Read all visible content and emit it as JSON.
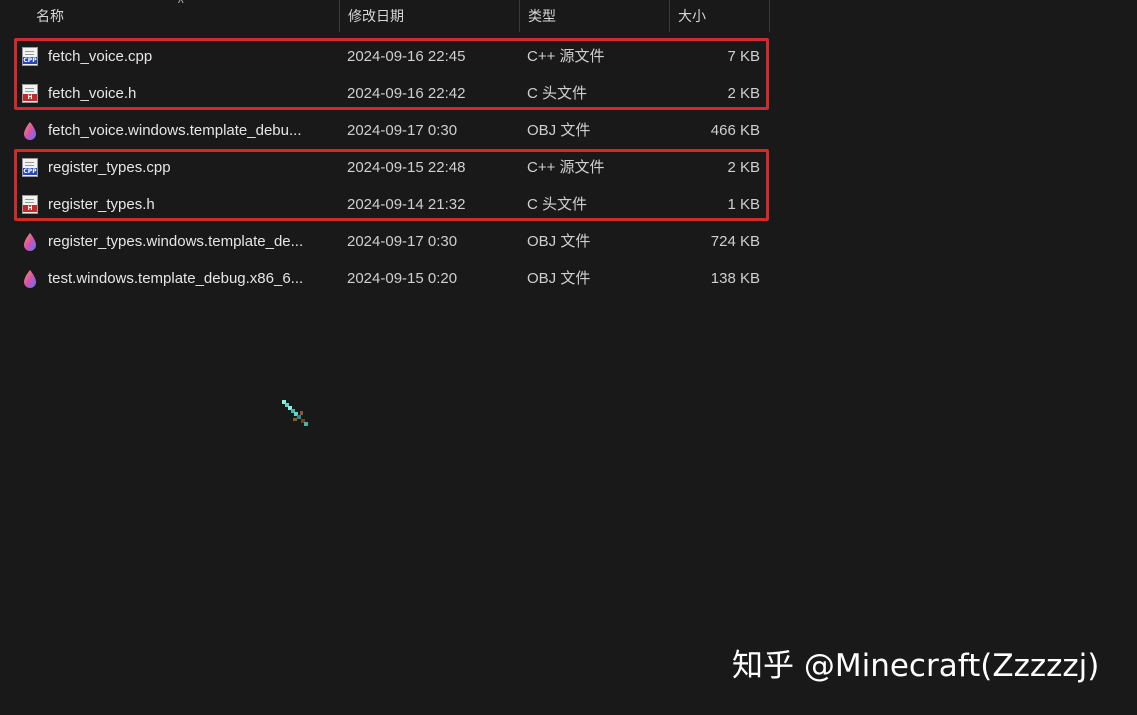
{
  "columns": {
    "name": "名称",
    "date": "修改日期",
    "type": "类型",
    "size": "大小"
  },
  "sort_indicator": "^",
  "files": [
    {
      "name": "fetch_voice.cpp",
      "date": "2024-09-16 22:45",
      "type": "C++ 源文件",
      "size": "7 KB",
      "icon": "cpp-file-icon"
    },
    {
      "name": "fetch_voice.h",
      "date": "2024-09-16 22:42",
      "type": "C 头文件",
      "size": "2 KB",
      "icon": "h-file-icon"
    },
    {
      "name": "fetch_voice.windows.template_debu...",
      "date": "2024-09-17 0:30",
      "type": "OBJ 文件",
      "size": "466 KB",
      "icon": "obj-file-icon"
    },
    {
      "name": "register_types.cpp",
      "date": "2024-09-15 22:48",
      "type": "C++ 源文件",
      "size": "2 KB",
      "icon": "cpp-file-icon"
    },
    {
      "name": "register_types.h",
      "date": "2024-09-14 21:32",
      "type": "C 头文件",
      "size": "1 KB",
      "icon": "h-file-icon"
    },
    {
      "name": "register_types.windows.template_de...",
      "date": "2024-09-17 0:30",
      "type": "OBJ 文件",
      "size": "724 KB",
      "icon": "obj-file-icon"
    },
    {
      "name": "test.windows.template_debug.x86_6...",
      "date": "2024-09-15 0:20",
      "type": "OBJ 文件",
      "size": "138 KB",
      "icon": "obj-file-icon"
    }
  ],
  "icon_labels": {
    "cpp": "CPP",
    "h": "H"
  },
  "highlight_color": "#d22a2a",
  "watermark": "知乎 @Minecraft(Zzzzzj)"
}
